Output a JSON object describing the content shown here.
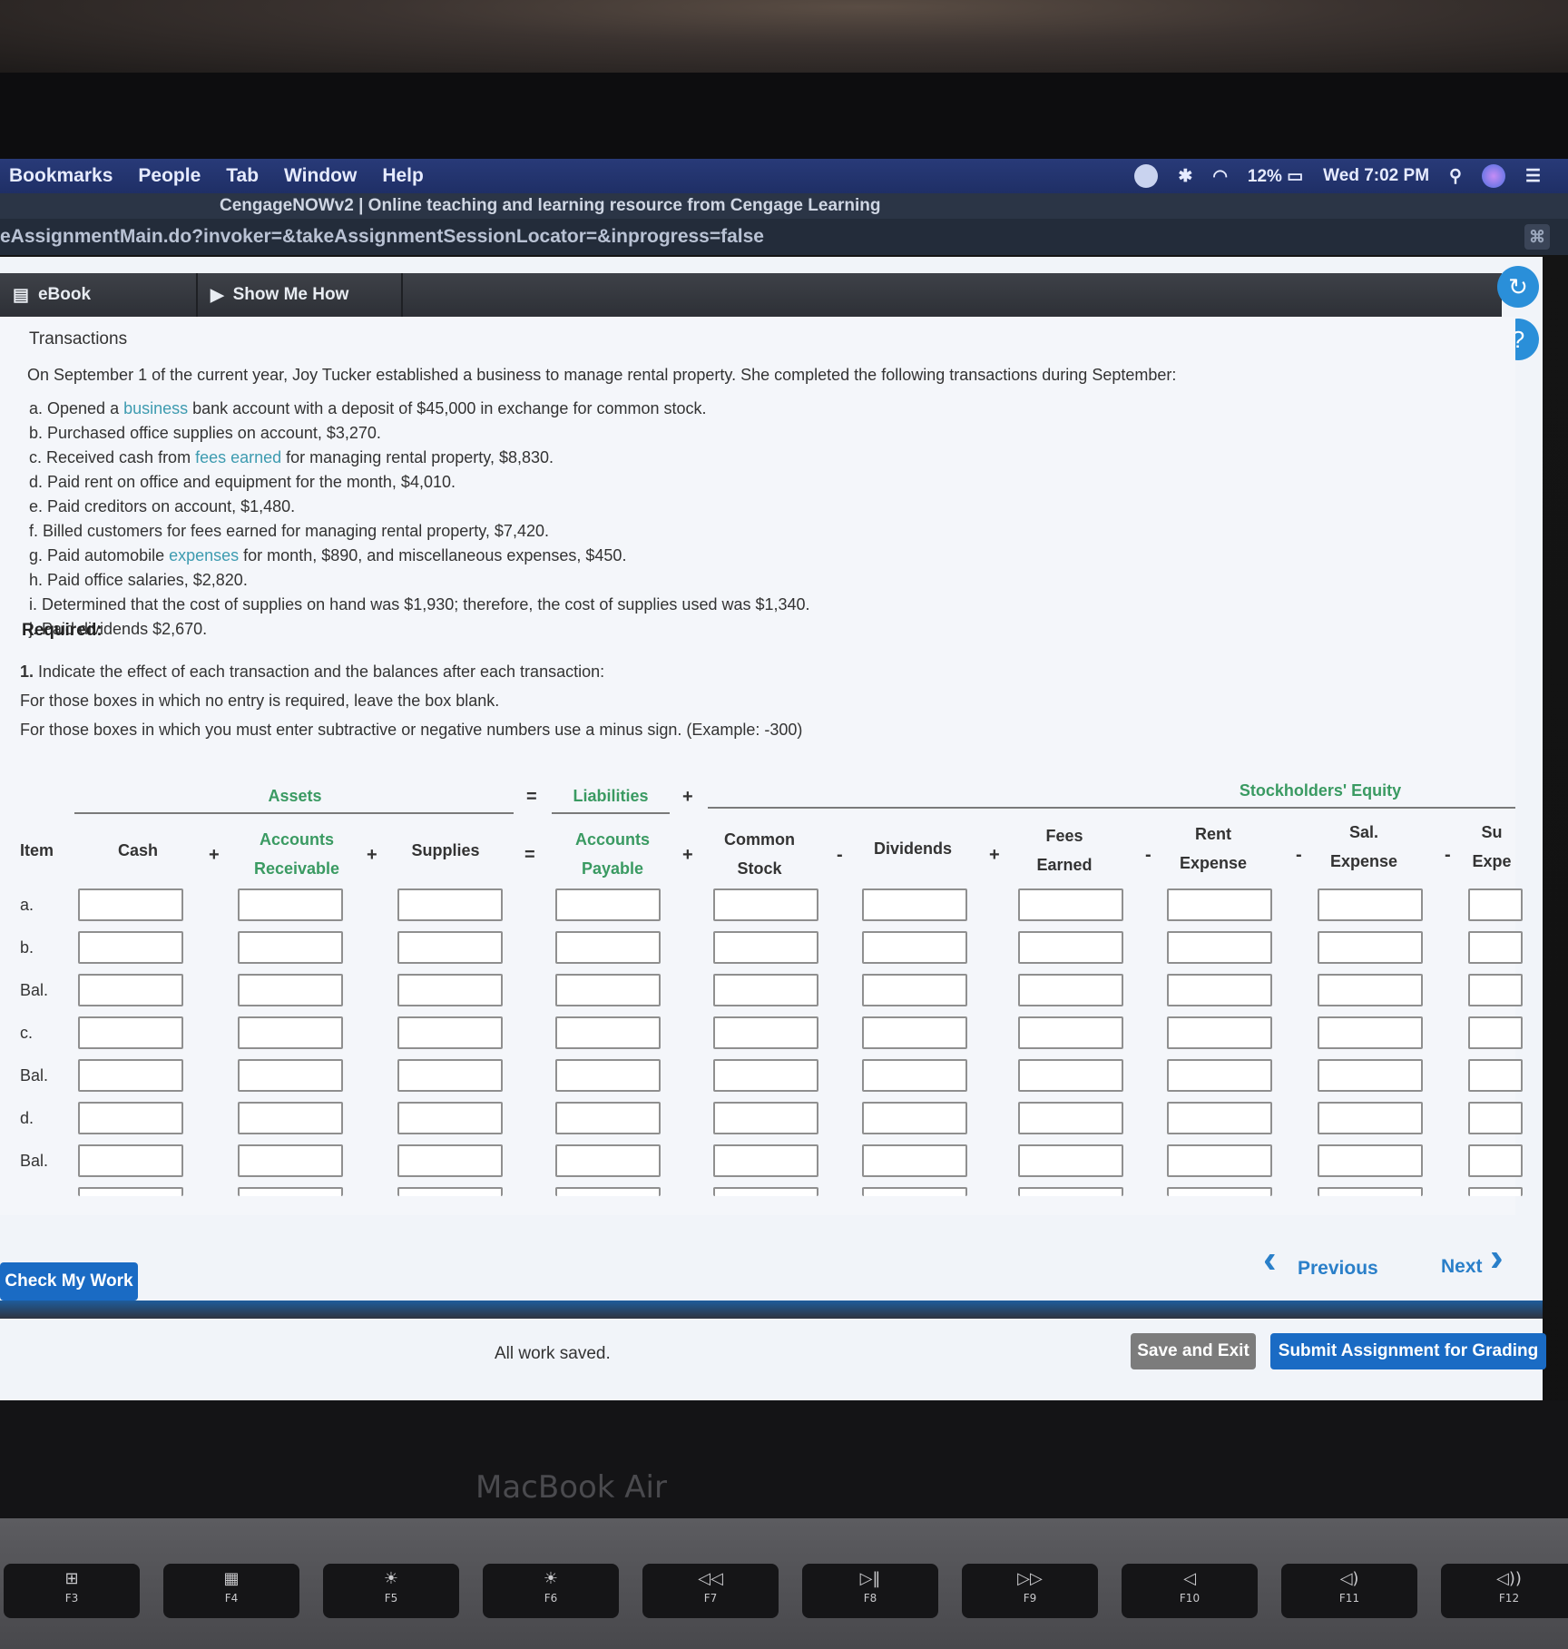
{
  "menubar": {
    "items": [
      "Bookmarks",
      "People",
      "Tab",
      "Window",
      "Help"
    ],
    "battery": "12%",
    "clock": "Wed 7:02 PM"
  },
  "window_title": "CengageNOWv2 | Online teaching and learning resource from Cengage Learning",
  "url": "eAssignmentMain.do?invoker=&takeAssignmentSessionLocator=&inprogress=false",
  "toolbar": {
    "ebook": "eBook",
    "show_me_how": "Show Me How"
  },
  "problem": {
    "heading": "Transactions",
    "intro": "On September 1 of the current year, Joy Tucker established a business to manage rental property. She completed the following transactions during September:",
    "transactions": [
      {
        "pre": "a. Opened a ",
        "link": "business",
        "post": " bank account with a deposit of $45,000 in exchange for common stock."
      },
      {
        "pre": "b. Purchased office supplies on account, $3,270.",
        "link": "",
        "post": ""
      },
      {
        "pre": "c. Received cash from ",
        "link": "fees earned",
        "post": " for managing rental property, $8,830."
      },
      {
        "pre": "d. Paid rent on office and equipment for the month, $4,010.",
        "link": "",
        "post": ""
      },
      {
        "pre": "e. Paid creditors on account, $1,480.",
        "link": "",
        "post": ""
      },
      {
        "pre": "f. Billed customers for fees earned for managing rental property, $7,420.",
        "link": "",
        "post": ""
      },
      {
        "pre": "g. Paid automobile ",
        "link": "expenses",
        "post": " for month, $890, and miscellaneous expenses, $450."
      },
      {
        "pre": "h. Paid office salaries, $2,820.",
        "link": "",
        "post": ""
      },
      {
        "pre": "i. Determined that the cost of supplies on hand was $1,930; therefore, the cost of supplies used was $1,340.",
        "link": "",
        "post": ""
      },
      {
        "pre": "j. Paid dividends $2,670.",
        "link": "",
        "post": ""
      }
    ],
    "required": "Required:",
    "instruction_num": "1.",
    "instruction_1": "Indicate the effect of each transaction and the balances after each transaction:",
    "instruction_2": "For those boxes in which no entry is required, leave the box blank.",
    "instruction_3": "For those boxes in which you must enter subtractive or negative numbers use a minus sign. (Example: -300)"
  },
  "equation": {
    "assets": "Assets",
    "liabilities": "Liabilities",
    "equity": "Stockholders' Equity",
    "eq1": "=",
    "plus1": "+",
    "columns": [
      {
        "line1": "Item",
        "line2": ""
      },
      {
        "line1": "Cash",
        "line2": ""
      },
      {
        "line1": "Accounts",
        "line2": "Receivable"
      },
      {
        "line1": "Supplies",
        "line2": ""
      },
      {
        "line1": "Accounts",
        "line2": "Payable"
      },
      {
        "line1": "Common",
        "line2": "Stock"
      },
      {
        "line1": "Dividends",
        "line2": ""
      },
      {
        "line1": "Fees",
        "line2": "Earned"
      },
      {
        "line1": "Rent",
        "line2": "Expense"
      },
      {
        "line1": "Sal.",
        "line2": "Expense"
      },
      {
        "line1": "Su",
        "line2": "Expe"
      }
    ],
    "operators": [
      "+",
      "+",
      "=",
      "+",
      "-",
      "+",
      "-",
      "-",
      "-"
    ],
    "rows": [
      "a.",
      "b.",
      "Bal.",
      "c.",
      "Bal.",
      "d.",
      "Bal."
    ]
  },
  "nav": {
    "previous": "Previous",
    "next": "Next"
  },
  "buttons": {
    "check": "Check My Work",
    "save_exit": "Save and Exit",
    "submit": "Submit Assignment for Grading"
  },
  "status": "All work saved.",
  "device": "MacBook Air",
  "keys": [
    "F3",
    "F4",
    "F5",
    "F6",
    "F7",
    "F8",
    "F9",
    "F10",
    "F11",
    "F12"
  ],
  "colors": {
    "accent_blue": "#1a6bc4",
    "equation_green": "#3a9a62",
    "link_teal": "#3d9bb0"
  }
}
